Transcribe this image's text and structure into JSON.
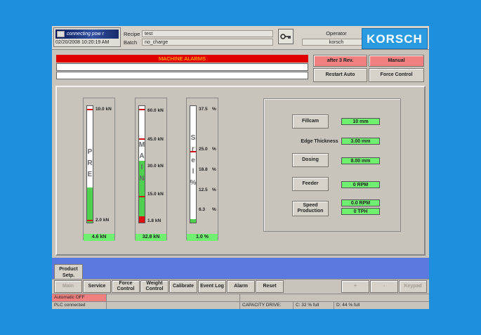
{
  "header": {
    "logo_text": "connecting pow r",
    "datetime": "02/20/2008  10:20:19 AM",
    "recipe_label": "Recipe",
    "recipe_value": "test",
    "batch_label": "Batch",
    "batch_value": "no_charge",
    "operator_label": "Operator",
    "operator_value": "korsch",
    "brand": "KORSCH"
  },
  "alarms": {
    "title": "MACHINE ALARMS"
  },
  "top_buttons": {
    "after_rev": "after 3 Rev.",
    "manual": "Manual",
    "restart_auto": "Restart Auto",
    "force_control": "Force Control"
  },
  "gauges": [
    {
      "word": [
        "P",
        "R",
        "E"
      ],
      "top_label": "10.0 kN",
      "low_label": "2.0 kN",
      "value": "4.6 kN",
      "fill_fraction": 0.3
    },
    {
      "word": [
        "M",
        "A",
        "I",
        "N"
      ],
      "labels": [
        "60.0 kN",
        "45.0 kN",
        "30.0 kN",
        "15.0 kN",
        "1.8 kN"
      ],
      "value": "32.8 kN",
      "fill_fraction": 0.53
    },
    {
      "word": [
        "S",
        "r",
        "e",
        "l",
        "%"
      ],
      "labels": [
        "37.5",
        "25.0",
        "18.8",
        "12.5",
        "6.3"
      ],
      "unit": "%",
      "value": "1.0 %",
      "fill_fraction": 0.03
    }
  ],
  "settings": {
    "fillcam_label": "Fillcam",
    "fillcam_value": "10 mm",
    "edge_label": "Edge Thickness",
    "edge_value": "3.00 mm",
    "dosing_label": "Dosing",
    "dosing_value": "8.00 mm",
    "feeder_label": "Feeder",
    "feeder_value": "0 RPM",
    "speed_label": "Speed Production",
    "speed_rpm": "0.0 RPM",
    "speed_tph": "0 TPH"
  },
  "tab_label": "Product Setp.",
  "nav": [
    "Main",
    "Service",
    "Force Control",
    "Weight Control",
    "Calibrate",
    "Event Log",
    "Alarm",
    "Reset"
  ],
  "nav_right": [
    "+",
    "-",
    "Keypad"
  ],
  "status": {
    "automatic": "Automatic OFF",
    "plc": "PLC connected",
    "capacity_label": "CAPACITY DRIVE:",
    "drive_c": "C:   32 % full",
    "drive_d": "D:   44 % full"
  },
  "colors": {
    "background": "#1e8fdd",
    "alarm_red": "#e00000",
    "value_green": "#70ee70",
    "band_blue": "#5a7adf"
  }
}
